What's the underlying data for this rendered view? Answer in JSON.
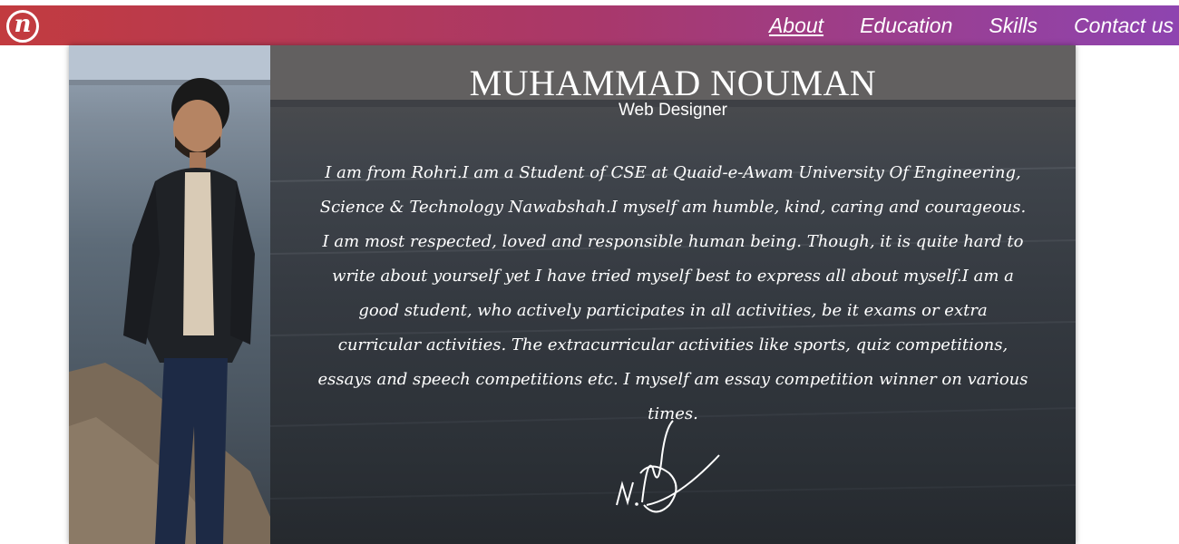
{
  "header": {
    "logo_letter": "n",
    "nav": [
      {
        "label": "About",
        "active": true
      },
      {
        "label": "Education",
        "active": false
      },
      {
        "label": "Skills",
        "active": false
      },
      {
        "label": "Contact us",
        "active": false
      }
    ],
    "gradient": [
      "#c23b3f",
      "#a9386a",
      "#8e44b0"
    ]
  },
  "profile": {
    "name": "MUHAMMAD NOUMAN",
    "role": "Web Designer",
    "bio": "I am from Rohri.I am a Student of CSE at Quaid-e-Awam University Of Engineering, Science & Technology Nawabshah.I myself am humble, kind, caring and courageous. I am most respected, loved and responsible human being. Though, it is quite hard to write about yourself yet I have tried myself best to express all about myself.I am a good student, who actively participates in all activities, be it exams or extra curricular activities. The extracurricular activities like sports, quiz competitions, essays and speech competitions etc. I myself am essay competition winner on various times.",
    "signature_text": "M.Nouman"
  }
}
